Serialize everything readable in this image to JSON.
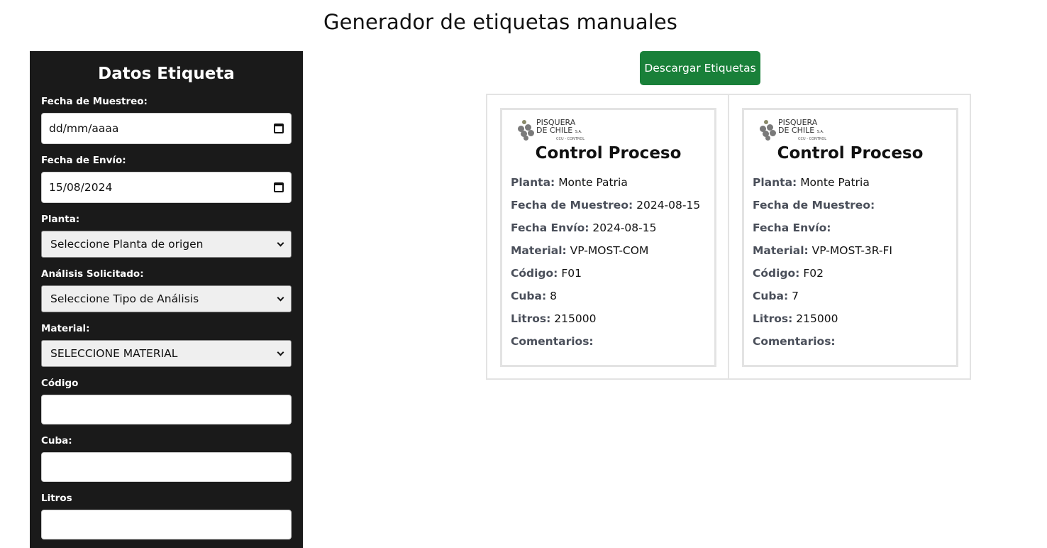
{
  "page": {
    "title": "Generador de etiquetas manuales"
  },
  "sidebar": {
    "title": "Datos Etiqueta",
    "fields": {
      "fecha_muestreo": {
        "label": "Fecha de Muestreo:",
        "value": "dd/mm/aaaa"
      },
      "fecha_envio": {
        "label": "Fecha de Envío:",
        "value": "15/08/2024"
      },
      "planta": {
        "label": "Planta:",
        "value": "Seleccione Planta de origen"
      },
      "analisis": {
        "label": "Análisis Solicitado:",
        "value": "Seleccione Tipo de Análisis"
      },
      "material": {
        "label": "Material:",
        "value": "SELECCIONE MATERIAL"
      },
      "codigo": {
        "label": "Código",
        "value": ""
      },
      "cuba": {
        "label": "Cuba:",
        "value": ""
      },
      "litros": {
        "label": "Litros",
        "value": ""
      }
    }
  },
  "toolbar": {
    "download_label": "Descargar Etiquetas",
    "accent": "#198039"
  },
  "labels": [
    {
      "logo": {
        "line1": "PISQUERA",
        "line2": "DE CHILE",
        "suffix": "S.A.",
        "line3": "CCU - CONTROL"
      },
      "title": "Control Proceso",
      "planta_k": "Planta:",
      "planta": "Monte Patria",
      "muestreo_k": "Fecha de Muestreo:",
      "muestreo": "2024-08-15",
      "envio_k": "Fecha Envío:",
      "envio": "2024-08-15",
      "material_k": "Material:",
      "material": "VP-MOST-COM",
      "codigo_k": "Código:",
      "codigo": "F01",
      "cuba_k": "Cuba:",
      "cuba": "8",
      "litros_k": "Litros:",
      "litros": "215000",
      "comentarios_k": "Comentarios:",
      "comentarios": ""
    },
    {
      "logo": {
        "line1": "PISQUERA",
        "line2": "DE CHILE",
        "suffix": "S.A.",
        "line3": "CCU - CONTROL"
      },
      "title": "Control Proceso",
      "planta_k": "Planta:",
      "planta": "Monte Patria",
      "muestreo_k": "Fecha de Muestreo:",
      "muestreo": "",
      "envio_k": "Fecha Envío:",
      "envio": "",
      "material_k": "Material:",
      "material": "VP-MOST-3R-FI",
      "codigo_k": "Código:",
      "codigo": "F02",
      "cuba_k": "Cuba:",
      "cuba": "7",
      "litros_k": "Litros:",
      "litros": "215000",
      "comentarios_k": "Comentarios:",
      "comentarios": ""
    }
  ]
}
